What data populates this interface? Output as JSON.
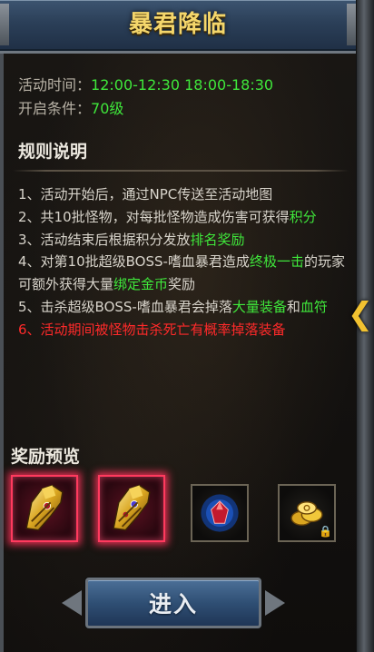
{
  "header": {
    "title": "暴君降临"
  },
  "info": {
    "time_label": "活动时间：",
    "time_value": "12:00-12:30 18:00-18:30",
    "level_label": "开启条件：",
    "level_value": "70级"
  },
  "rules": {
    "title": "规则说明",
    "r1": "1、活动开始后，通过NPC传送至活动地图",
    "r2a": "2、共10批怪物，对每批怪物造成伤害可获得",
    "r2b": "积分",
    "r3a": "3、活动结束后根据积分发放",
    "r3b": "排名奖励",
    "r4a": "4、对第10批超级BOSS-嗜血暴君造成",
    "r4b": "终极",
    "r4c": "一击",
    "r4d": "的玩家可额外获得大量",
    "r4e": "绑定金币",
    "r4f": "奖励",
    "r5a": "5、击杀超级BOSS-嗜血暴君会掉落",
    "r5b": "大量装备",
    "r5c": "和",
    "r5d": "血符",
    "r6": "6、活动期间被怪物击杀死亡有概率掉落装备"
  },
  "rewards": {
    "title": "奖励预览",
    "items": [
      {
        "icon": "golden-gauntlet-icon",
        "rarity": "legendary"
      },
      {
        "icon": "golden-gauntlet-icon",
        "rarity": "legendary"
      },
      {
        "icon": "red-gem-icon",
        "rarity": "normal"
      },
      {
        "icon": "gold-coins-icon",
        "rarity": "normal",
        "locked": true
      }
    ]
  },
  "enter_button": {
    "label": "进入"
  },
  "colors": {
    "title": "#f4d66b",
    "highlight_green": "#3fe73b",
    "warning_red": "#ff2a2a",
    "glow_border": "#ff3a5e",
    "button_blue": "#2f4f74"
  }
}
